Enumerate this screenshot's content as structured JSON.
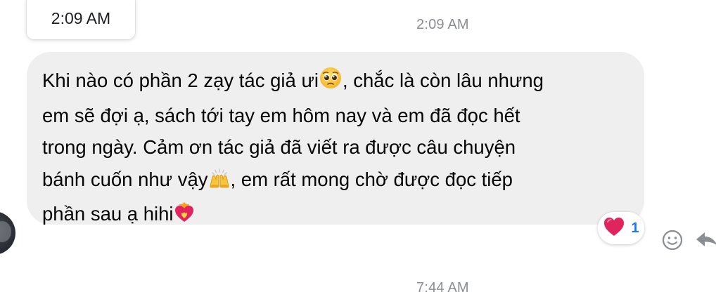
{
  "tooltip": {
    "time": "2:09 AM"
  },
  "timestamps": {
    "top": "2:09 AM",
    "bottom": "7:44 AM"
  },
  "message": {
    "lines": [
      {
        "before": "Khi nào có phần 2 zạy tác giả ưi",
        "emoji": "pleading-face-icon",
        "after": ", chắc là còn lâu nhưng"
      },
      {
        "before": "em sẽ đợi ạ, sách tới tay em hôm nay và em đã đọc hết",
        "emoji": "",
        "after": ""
      },
      {
        "before": "trong ngày. Cảm ơn tác giả đã viết ra được câu chuyện",
        "emoji": "",
        "after": ""
      },
      {
        "before": "bánh cuốn như vậy",
        "emoji": "raising-hands-icon",
        "after": ", em rất mong chờ được đọc tiếp"
      },
      {
        "before": "phần sau ạ hihi",
        "emoji": "heart-on-fire-icon",
        "after": ""
      }
    ]
  },
  "reaction": {
    "emoji": "red-heart-icon",
    "count": "1"
  },
  "colors": {
    "bubble": "#efefef",
    "text": "#050505",
    "timestamp": "#8a8d91",
    "reaction_count": "#1877f2",
    "heart": "#e0245e"
  }
}
